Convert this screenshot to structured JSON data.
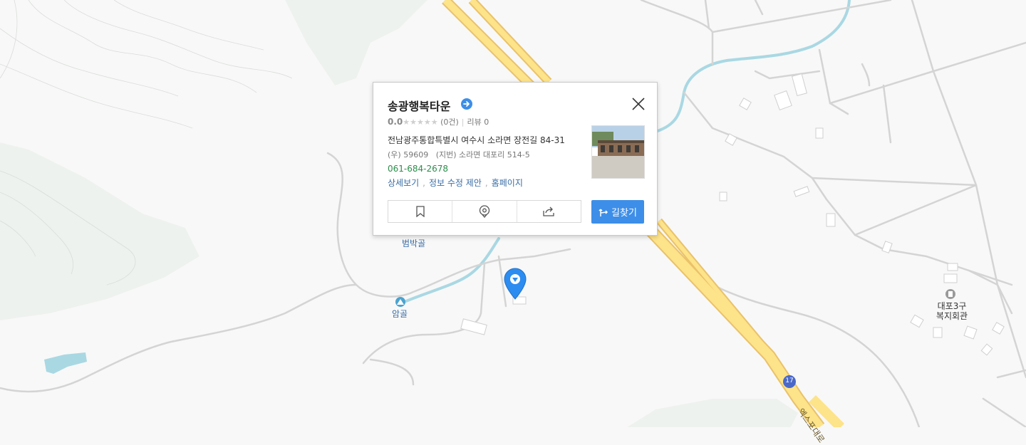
{
  "map": {
    "labels": {
      "beombakgol": "범박골",
      "amgol": "암골",
      "welfare_center": "대포3구\n복지회관",
      "road_number": "17",
      "road_name": "엑스포대로"
    }
  },
  "popup": {
    "title": "송광행복타운",
    "rating_score": "0.0",
    "rating_stars": "★★★★★",
    "rating_count": "(0건)",
    "review_label": "리뷰 0",
    "address_road": "전남광주통합특별시 여수시 소라면 장전길 84-31",
    "address_postal": "(우) 59609",
    "address_lot": "(지번) 소라면 대포리 514-5",
    "phone": "061-684-2678",
    "links": [
      "상세보기",
      "정보 수정 제안",
      "홈페이지"
    ],
    "route_label": "길찾기",
    "actions": [
      "bookmark-icon",
      "location-pin-icon",
      "share-icon"
    ]
  },
  "colors": {
    "accent": "#3d8ee8",
    "phone": "#2c8c4c",
    "link": "#3a6ea5",
    "highway": "#fde38a",
    "water": "#a9d8e3",
    "terrain": "#eef2ee"
  }
}
